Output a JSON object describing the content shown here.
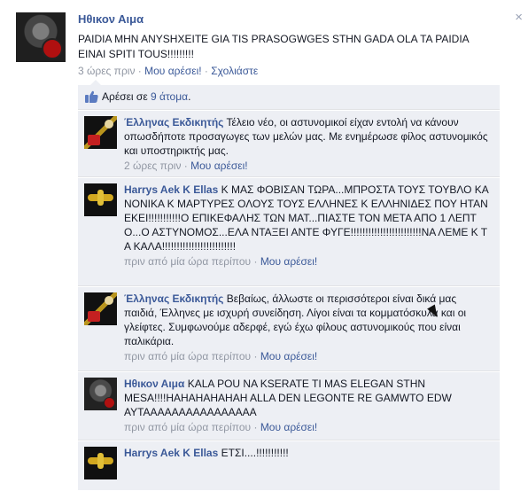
{
  "post": {
    "author": "Ηθικον Αιμα",
    "text": "PAIDIA MHN ANYSHXEITE GIA TIS PRASOGWGES STHN GADA OLA TA PAIDIA EINAI SPITI TOUS!!!!!!!!!",
    "time": "3 ώρες πριν",
    "like_label": "Μου αρέσει!",
    "comment_label": "Σχολιάστε",
    "close_icon": "×"
  },
  "likes": {
    "prefix": "Αρέσει σε ",
    "count_link": "9 άτομα",
    "suffix": "."
  },
  "comments": [
    {
      "author": "Έλληνας Εκδικητής",
      "text": "Τέλειο νέο, οι αστυνομικοί είχαν εντολή να κάνουν οπωσδήποτε προσαγωγες των μελών μας. Με ενημέρωσε φίλος αστυνομικός και υποστηρικτής μας.",
      "time": "2 ώρες πριν",
      "like_label": "Μου αρέσει!"
    },
    {
      "author": "Harrys Aek K Ellas",
      "text": "Κ ΜΑΣ ΦΟΒΙΣΑΝ ΤΩΡΑ...ΜΠΡΟΣΤΑ ΤΟΥΣ ΤΟΥΒΛΟ ΚΑΝΟΝΙΚΑ Κ ΜΑΡΤΥΡΕΣ ΟΛΟΥΣ ΤΟΥΣ ΕΛΛΗΝΕΣ Κ ΕΛΛΗΝΙΔΕΣ ΠΟΥ ΗΤΑΝ ΕΚΕΙ!!!!!!!!!!!Ο ΕΠΙΚΕΦΑΛΗΣ ΤΩΝ ΜΑΤ...ΠΙΑΣΤΕ ΤΟΝ ΜΕΤΑ ΑΠΟ 1 ΛΕΠΤΟ...Ο ΑΣΤΥΝΟΜΟΣ...ΕΛΑ ΝΤΑΞΕΙ ΑΝΤΕ ΦΥΓΕ!!!!!!!!!!!!!!!!!!!!!!!!ΝΑ ΛΕΜΕ Κ ΤΑ ΚΑΛΑ!!!!!!!!!!!!!!!!!!!!!!!!!",
      "time": "πριν από μία ώρα περίπου",
      "like_label": "Μου αρέσει!"
    },
    {
      "author": "Έλληνας Εκδικητής",
      "text": "Βεβαίως, άλλωστε οι περισσότεροι είναι δικά μας παιδιά, Έλληνες με ισχυρή συνείδηση. Λίγοι είναι τα κομματόσκυλα και οι γλείφτες. Συμφωνούμε αδερφέ, εγώ έχω φίλους αστυνομικούς που είναι παλικάρια.",
      "time": "πριν από μία ώρα περίπου",
      "like_label": "Μου αρέσει!"
    },
    {
      "author": "Ηθικον Αιμα",
      "text": "KALA POU NA KSERATE TI MAS ELEGAN STHN MESA!!!!HAHAHAHAHAH ALLA DEN LEGONTE RE GAMWTO EDW AYTAAAAAAAAAAAAAAAA",
      "time": "πριν από μία ώρα περίπου",
      "like_label": "Μου αρέσει!"
    },
    {
      "author": "Harrys Aek K Ellas",
      "text": "ΕΤΣΙ....!!!!!!!!!!!",
      "time": "",
      "like_label": ""
    }
  ],
  "colors": {
    "link": "#3b5998",
    "meta": "#9197a3",
    "feedback_bg": "#edeff4"
  }
}
